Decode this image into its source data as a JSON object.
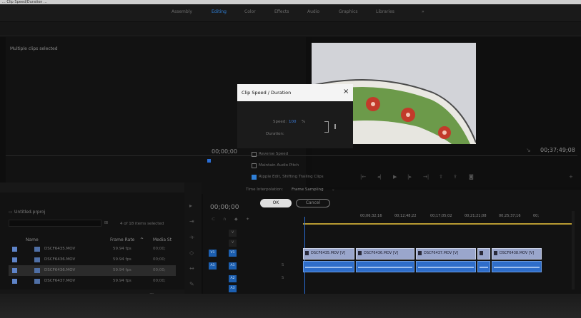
{
  "caption": "... Clip Speed/Duration ...",
  "workspaces": [
    "Assembly",
    "Editing",
    "Color",
    "Effects",
    "Audio",
    "Graphics",
    "Libraries"
  ],
  "active_workspace": "Editing",
  "source_panel": {
    "selection_label": "Multiple clips selected"
  },
  "program_monitor": {
    "timecode": "00;37;49;08",
    "left_timecode": "00;00;00"
  },
  "dialog": {
    "title": "Clip Speed / Duration",
    "speed_label": "Speed:",
    "speed_value": "100",
    "speed_unit": "%",
    "duration_label": "Duration:",
    "reverse_speed": "Reverse Speed",
    "maintain_audio_pitch": "Maintain Audio Pitch",
    "ripple_edit": "Ripple Edit, Shifting Trailing Clips",
    "time_interp_label": "Time Interpolation:",
    "time_interp_value": "Frame Sampling",
    "ok": "OK",
    "cancel": "Cancel",
    "checks": {
      "reverse": false,
      "maintain": false,
      "ripple": true
    }
  },
  "project": {
    "name": "Untitled.prproj",
    "items_selected": "4 of 18 items selected",
    "columns": {
      "name": "Name",
      "frame_rate": "Frame Rate",
      "media_start": "Media St"
    },
    "clips": [
      {
        "name": "DSCF6435.MOV",
        "frame_rate": "59.94 fps",
        "media_start": "00;00;"
      },
      {
        "name": "DSCF6436.MOV",
        "frame_rate": "59.94 fps",
        "media_start": "00;00;"
      },
      {
        "name": "DSCF6436.MOV",
        "frame_rate": "59.94 fps",
        "media_start": "00;00;"
      },
      {
        "name": "DSCF6437.MOV",
        "frame_rate": "59.94 fps",
        "media_start": "00;00;"
      }
    ]
  },
  "timeline": {
    "timecode": "00;00;00",
    "ruler": [
      "00;06;32;16",
      "00;12;48;22",
      "00;17;05;02",
      "00;21;21;08",
      "00;25;37;16",
      "00;"
    ],
    "video_clips": [
      "DSCF6435.MOV [V]",
      "DSCF6436.MOV [V]",
      "DSCF6437.MOV [V]",
      "DSCF6438.MOV [V]"
    ],
    "tracks": {
      "v1": "V1",
      "a1": "A1",
      "a2": "A2",
      "a3": "A3"
    }
  }
}
